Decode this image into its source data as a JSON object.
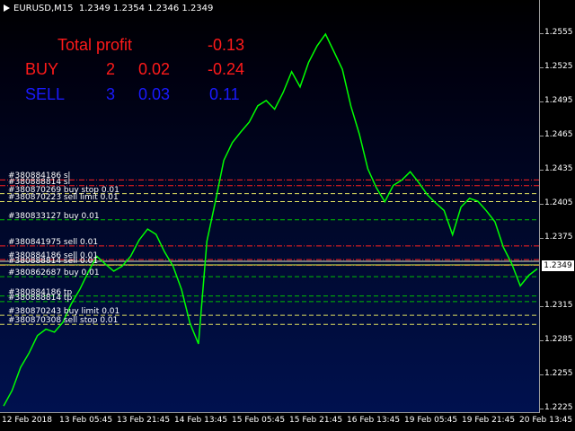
{
  "chart": {
    "symbol": "EURUSD,M15",
    "open": "1.2349",
    "high": "1.2354",
    "low": "1.2346",
    "close": "1.2349",
    "current_price": "1.2349",
    "colors": {
      "background_top": "#000000",
      "background_bottom": "#00114f",
      "price_line": "#00ff00",
      "bid_line": "#e0e0c0",
      "sell_line": "#ff2020",
      "buy_line": "#00c000",
      "pending_line": "#e0e060",
      "profit_red": "#ff1a1a",
      "profit_blue": "#1a1aff"
    }
  },
  "stats": {
    "total_label": "Total profit",
    "total_value": "-0.13",
    "buy_label": "BUY",
    "buy_count": "2",
    "buy_lots": "0.02",
    "buy_profit": "-0.24",
    "sell_label": "SELL",
    "sell_count": "3",
    "sell_lots": "0.03",
    "sell_profit": "0.11"
  },
  "price_axis": [
    "1.2555",
    "1.2525",
    "1.2495",
    "1.2465",
    "1.2435",
    "1.2405",
    "1.2375",
    "1.2315",
    "1.2285",
    "1.2255",
    "1.2225"
  ],
  "time_axis": [
    "12 Feb 2018",
    "13 Feb 05:45",
    "13 Feb 21:45",
    "14 Feb 13:45",
    "15 Feb 05:45",
    "15 Feb 21:45",
    "16 Feb 13:45",
    "19 Feb 05:45",
    "19 Feb 21:45",
    "20 Feb 13:45"
  ],
  "order_labels": [
    {
      "text": "#380884186 sl",
      "price": 1.2426,
      "kind": "sell"
    },
    {
      "text": "#380888814 sl",
      "price": 1.2421,
      "kind": "sell"
    },
    {
      "text": "#380870269 buy stop 0.01",
      "price": 1.2414,
      "kind": "pending"
    },
    {
      "text": "#380870223 sell limit 0.01",
      "price": 1.2407,
      "kind": "pending"
    },
    {
      "text": "#380833127 buy 0.01",
      "price": 1.2391,
      "kind": "buy"
    },
    {
      "text": "#380841975 sell 0.01",
      "price": 1.2368,
      "kind": "sell"
    },
    {
      "text": "#380884186 sell 0.01",
      "price": 1.2356,
      "kind": "sell"
    },
    {
      "text": "#380888814 sell 0.01",
      "price": 1.2351,
      "kind": "sell"
    },
    {
      "text": "#380862687 buy 0.01",
      "price": 1.2341,
      "kind": "buy"
    },
    {
      "text": "#380884186 tp",
      "price": 1.2324,
      "kind": "buy"
    },
    {
      "text": "#380888814 tp",
      "price": 1.2319,
      "kind": "buy"
    },
    {
      "text": "#380870243 buy limit 0.01",
      "price": 1.2307,
      "kind": "pending"
    },
    {
      "text": "#380870308 sell stop 0.01",
      "price": 1.2299,
      "kind": "pending"
    }
  ],
  "price_series": [
    1.2226,
    1.2242,
    1.226,
    1.2275,
    1.2288,
    1.2296,
    1.2291,
    1.2302,
    1.2316,
    1.2331,
    1.2344,
    1.236,
    1.2351,
    1.2347,
    1.2349,
    1.236,
    1.2372,
    1.2384,
    1.2377,
    1.2364,
    1.2349,
    1.2331,
    1.2299,
    1.2283,
    1.2371,
    1.2408,
    1.2442,
    1.246,
    1.2467,
    1.2478,
    1.249,
    1.2497,
    1.2487,
    1.2504,
    1.252,
    1.2509,
    1.2528,
    1.2545,
    1.2553,
    1.254,
    1.2522,
    1.2492,
    1.2465,
    1.2437,
    1.2418,
    1.2408,
    1.242,
    1.2427,
    1.2432,
    1.2425,
    1.2412,
    1.2407,
    1.2398,
    1.2379,
    1.2401,
    1.2411,
    1.2406,
    1.24,
    1.2388,
    1.2368,
    1.2351,
    1.2334,
    1.2341,
    1.2349
  ]
}
